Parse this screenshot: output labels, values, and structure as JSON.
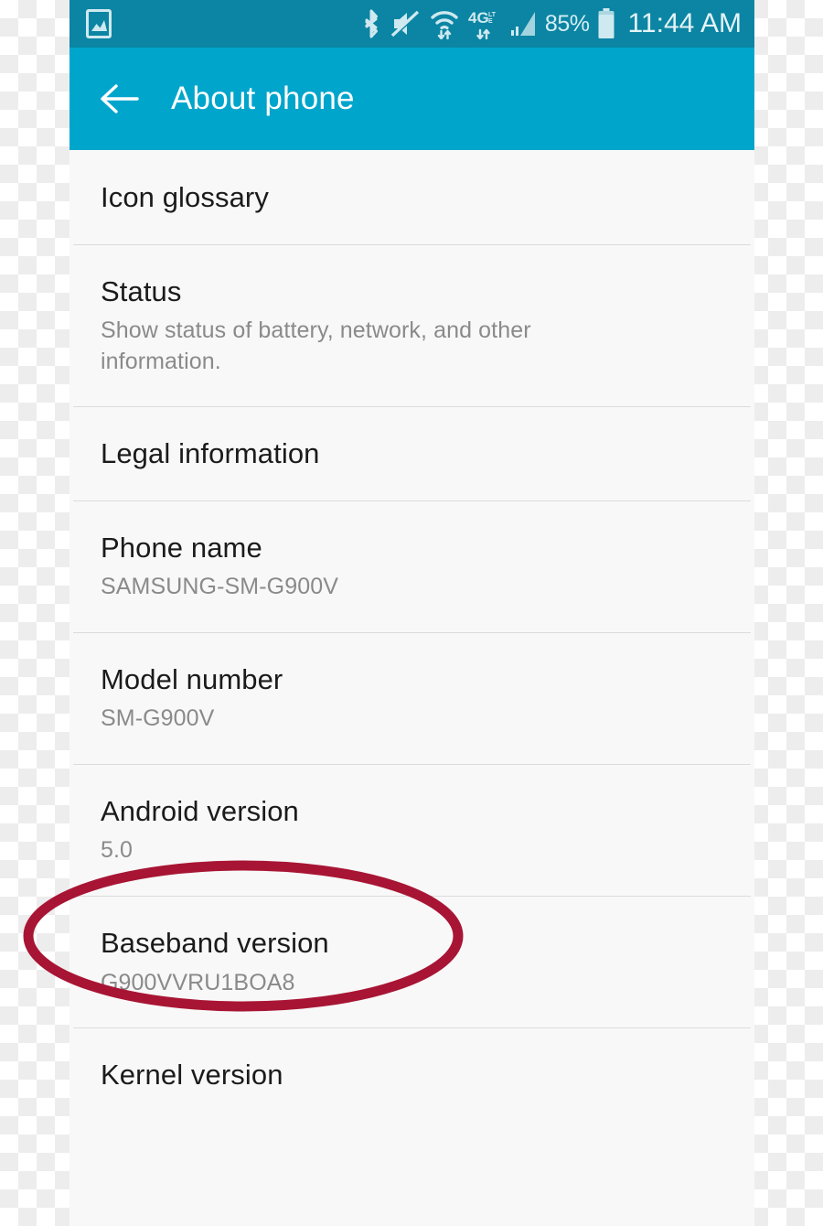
{
  "status_bar": {
    "background_color": "#0b85a3",
    "notification_icons": [
      "screenshot-image-icon"
    ],
    "system_icons": [
      "bluetooth-icon",
      "sound-muted-icon",
      "wifi-icon",
      "4g-lte-icon",
      "cellular-signal-icon"
    ],
    "battery_percent": "85%",
    "clock": "11:44 AM"
  },
  "app_bar": {
    "background_color": "#00a5cc",
    "back_icon": "arrow-left-icon",
    "title": "About phone"
  },
  "list": {
    "items": [
      {
        "title": "Icon glossary",
        "subtitle": ""
      },
      {
        "title": "Status",
        "subtitle": "Show status of battery, network, and other information."
      },
      {
        "title": "Legal information",
        "subtitle": ""
      },
      {
        "title": "Phone name",
        "subtitle": "SAMSUNG-SM-G900V"
      },
      {
        "title": "Model number",
        "subtitle": "SM-G900V"
      },
      {
        "title": "Android version",
        "subtitle": "5.0"
      },
      {
        "title": "Baseband version",
        "subtitle": "G900VVRU1BOA8"
      },
      {
        "title": "Kernel version",
        "subtitle": ""
      }
    ]
  },
  "annotation": {
    "shape": "ellipse",
    "color": "#a81534",
    "stroke_width": 11,
    "targets": "Android version"
  }
}
